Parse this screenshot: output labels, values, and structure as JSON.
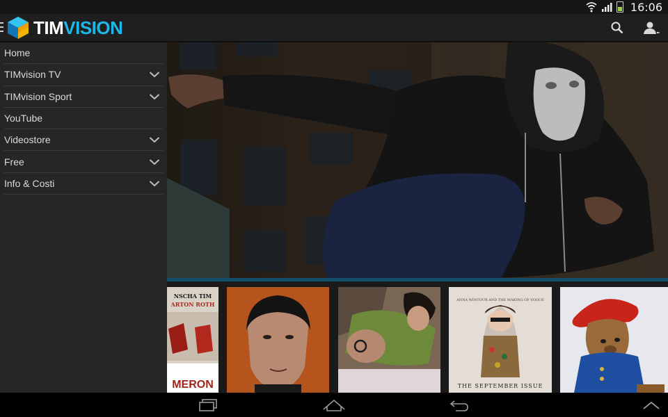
{
  "status_bar": {
    "time": "16:06",
    "icons": [
      "wifi-icon",
      "signal-icon",
      "battery-icon"
    ],
    "battery_level": 0.45
  },
  "app_bar": {
    "logo": {
      "part1": "TIM",
      "part2": "VISION"
    },
    "actions": [
      "search-icon",
      "account-icon"
    ]
  },
  "drawer": {
    "items": [
      {
        "label": "Home",
        "expandable": false
      },
      {
        "label": "TIMvision TV",
        "expandable": true
      },
      {
        "label": "TIMvision Sport",
        "expandable": true
      },
      {
        "label": "YouTube",
        "expandable": false
      },
      {
        "label": "Videostore",
        "expandable": true
      },
      {
        "label": "Free",
        "expandable": true
      },
      {
        "label": "Info & Costi",
        "expandable": true
      }
    ]
  },
  "carousel": {
    "posters": [
      {
        "caption_top": "NSCHA   TIM",
        "caption_top2": "ARTON  ROTH",
        "caption_bottom": "MERON"
      },
      {
        "caption_top": "",
        "caption_bottom": ""
      },
      {
        "caption_top": "",
        "caption_bottom": ""
      },
      {
        "caption_top": "ANNA WINTOUR AND THE MAKING OF VOGUE",
        "caption_bottom": "THE SEPTEMBER ISSUE"
      },
      {
        "caption_top": "",
        "caption_bottom": ""
      }
    ]
  },
  "colors": {
    "accent": "#1fb6e8",
    "drawer_bg": "#262626",
    "appbar_bg": "#1f1f1f"
  },
  "nav_bar": {
    "buttons": [
      "recent-apps-icon",
      "home-icon",
      "back-icon",
      "chevron-up-icon"
    ]
  }
}
